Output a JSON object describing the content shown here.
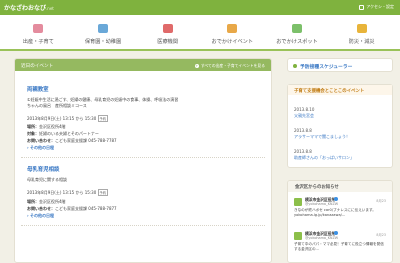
{
  "site": {
    "logo": "かなざわおなび",
    "logo_suffix": ".net",
    "top_right": "アクセシ・設定"
  },
  "nav": [
    {
      "label": "出産・子育て",
      "color": "#e48c9e"
    },
    {
      "label": "保育園・幼稚園",
      "color": "#6aa8d8"
    },
    {
      "label": "医療機関",
      "color": "#e06a6a"
    },
    {
      "label": "おでかけイベント",
      "color": "#e8a848"
    },
    {
      "label": "おでかけスポット",
      "color": "#7cc06a"
    },
    {
      "label": "防災・減災",
      "color": "#e8b43a"
    }
  ],
  "main": {
    "heading": "近日のイベント",
    "header_link": "すべての出産・子育てイベントを見る",
    "events": [
      {
        "title": "両親教室",
        "desc1": "①妊娠中生活に過ごす、妊婦の健康、母乳育児の妊娠中の食事、体操、呼吸法の演習",
        "desc2": "ちゃんの風呂　産所相談ミコース",
        "date": "2013年8月9日(土) 13:15 から 15:30",
        "badge": "予約",
        "place_label": "場所：",
        "place": "金沢区役所4階",
        "target_label": "対象：",
        "target": "妊婦のいる夫婦とそのパートナー",
        "contact_label": "お問い合わせ：",
        "contact": "こども家庭支援課 045-788-7787",
        "more": "その他の日程"
      },
      {
        "title": "母乳育児相談",
        "desc1": "母乳育児に関する相談",
        "date": "2013年8月9日(土) 13:15 から 15:30",
        "badge": "予約",
        "place_label": "場所：",
        "place": "金沢区役所4階",
        "contact_label": "お問い合わせ：",
        "contact": "こども家庭支援課 045-788-7877",
        "more": "その他の日程"
      }
    ]
  },
  "sidebar": {
    "schedule_title": "予防接種スケジューラー",
    "events_heading": "子育て支援機会とことこのイベント",
    "event_items": [
      {
        "date": "2013.8.10",
        "title": "父親先宮会"
      },
      {
        "date": "2013.8.8",
        "title": "アラサーママで聞こましょう！"
      },
      {
        "date": "2013.8.8",
        "title": "助産師さんの「おっぱいサロン」"
      }
    ],
    "news_heading": "金沢区からのお知らせ",
    "tweets": [
      {
        "name": "横浜市金沢区役所",
        "handle": "@yokohama_KNZW",
        "time": "8月23",
        "text": "きなのが終ハポセ car0/プナレスにに伝えいます。 yokohama.lg.jp/kanazawa/..."
      },
      {
        "name": "横浜市金沢区役所",
        "handle": "@yokohama_KNZW",
        "time": "8月23",
        "text": "子育て中のパパ・ママ必見！子育てに役立つ情報を発信する金沢区の..."
      }
    ]
  }
}
